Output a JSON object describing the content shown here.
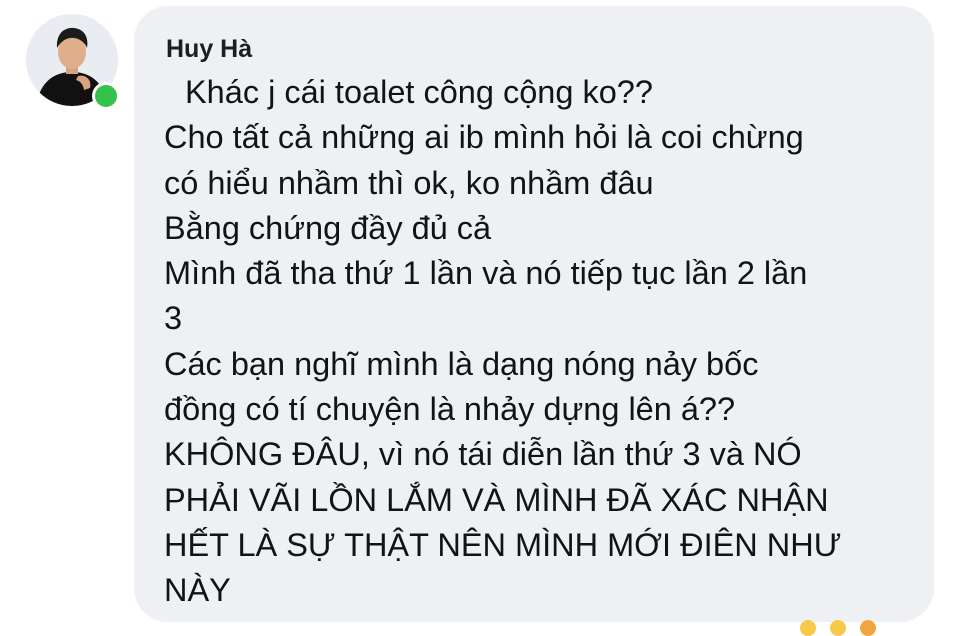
{
  "comment": {
    "author": "Huy Hà",
    "lines": [
      "Khác j cái toalet công cộng ko??",
      "Cho tất cả những ai ib mình hỏi là coi chừng",
      "có hiểu nhầm thì ok, ko nhầm đâu",
      "Bằng chứng đầy đủ cả",
      "Mình đã tha thứ 1 lần và nó tiếp tục lần 2 lần",
      "3",
      "Các bạn nghĩ mình là dạng nóng nảy bốc",
      "đồng có tí chuyện là nhảy dựng lên á??",
      "KHÔNG ĐÂU, vì nó tái diễn lần thứ 3 và NÓ",
      "PHẢI VÃI LỒN LẮM VÀ MÌNH ĐÃ XÁC NHẬN",
      "HẾT LÀ SỰ THẬT NÊN MÌNH MỚI ĐIÊN NHƯ",
      "NÀY"
    ]
  },
  "presence": {
    "status": "online",
    "dot_color": "#34c24c"
  },
  "colors": {
    "bubble_background": "#eef0f4",
    "text": "#111317",
    "page_background": "#ffffff"
  },
  "icons": {
    "avatar": "profile-photo",
    "presence": "online-status-dot"
  }
}
